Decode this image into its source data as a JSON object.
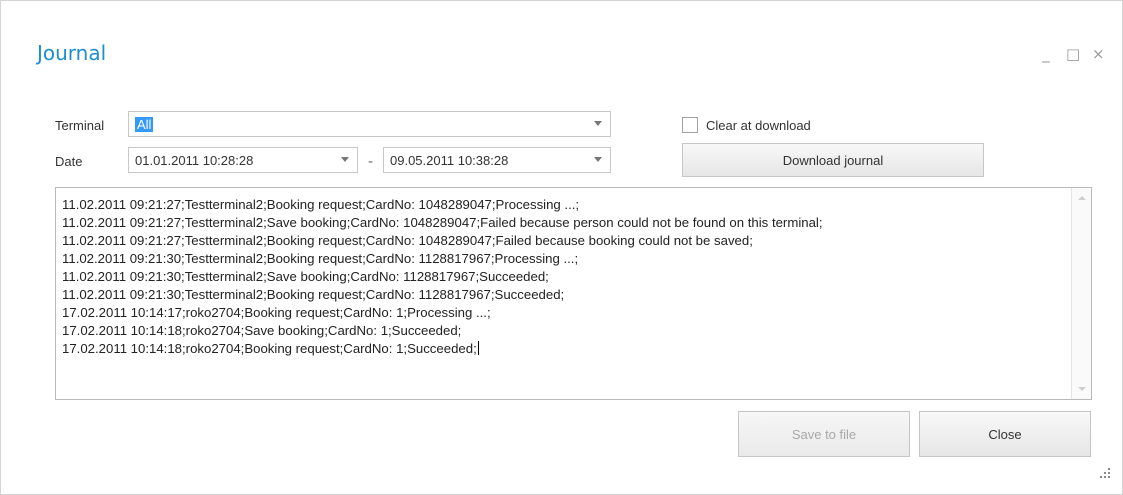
{
  "window": {
    "title": "Journal",
    "controls": {
      "minimize": "_",
      "maximize": "□",
      "close": "×"
    }
  },
  "filters": {
    "terminal_label": "Terminal",
    "terminal_value": "All",
    "date_label": "Date",
    "date_from": "01.01.2011 10:28:28",
    "date_separator": "-",
    "date_to": "09.05.2011 10:38:28"
  },
  "options": {
    "clear_at_download_label": "Clear at download",
    "clear_at_download_checked": false
  },
  "buttons": {
    "download_journal": "Download journal",
    "save_to_file": "Save to file",
    "close": "Close"
  },
  "log_lines": [
    "11.02.2011 09:21:27;Testterminal2;Booking request;CardNo: 1048289047;Processing ...;",
    "11.02.2011 09:21:27;Testterminal2;Save booking;CardNo: 1048289047;Failed because person could not be found on this terminal;",
    "11.02.2011 09:21:27;Testterminal2;Booking request;CardNo: 1048289047;Failed because booking could not be saved;",
    "11.02.2011 09:21:30;Testterminal2;Booking request;CardNo: 1128817967;Processing ...;",
    "11.02.2011 09:21:30;Testterminal2;Save booking;CardNo: 1128817967;Succeeded;",
    "11.02.2011 09:21:30;Testterminal2;Booking request;CardNo: 1128817967;Succeeded;",
    "17.02.2011 10:14:17;roko2704;Booking request;CardNo: 1;Processing ...;",
    "17.02.2011 10:14:18;roko2704;Save booking;CardNo: 1;Succeeded;",
    "17.02.2011 10:14:18;roko2704;Booking request;CardNo: 1;Succeeded;"
  ],
  "colors": {
    "title": "#1e8ed1",
    "selection": "#3399ff"
  }
}
